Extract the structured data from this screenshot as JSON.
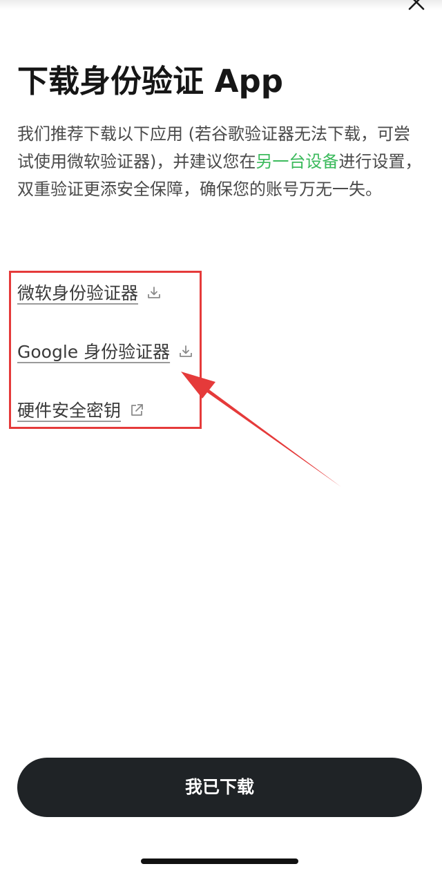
{
  "header": {
    "close_icon": "close-icon"
  },
  "page": {
    "title": "下载身份验证 App",
    "description_before": "我们推荐下载以下应用 (若谷歌验证器无法下载，可尝试使用微软验证器)，并建议您在",
    "description_link": "另一台设备",
    "description_after": "进行设置，双重验证更添安全保障，确保您的账号万无一失。"
  },
  "apps": [
    {
      "label": "微软身份验证器",
      "icon": "download-icon"
    },
    {
      "label": "Google 身份验证器",
      "icon": "download-icon"
    },
    {
      "label": "硬件安全密钥",
      "icon": "external-link-icon"
    }
  ],
  "footer": {
    "confirm_label": "我已下载"
  },
  "colors": {
    "accent_green": "#3bba5c",
    "annotation_red": "#e53a3a",
    "button_dark": "#1f2326"
  }
}
